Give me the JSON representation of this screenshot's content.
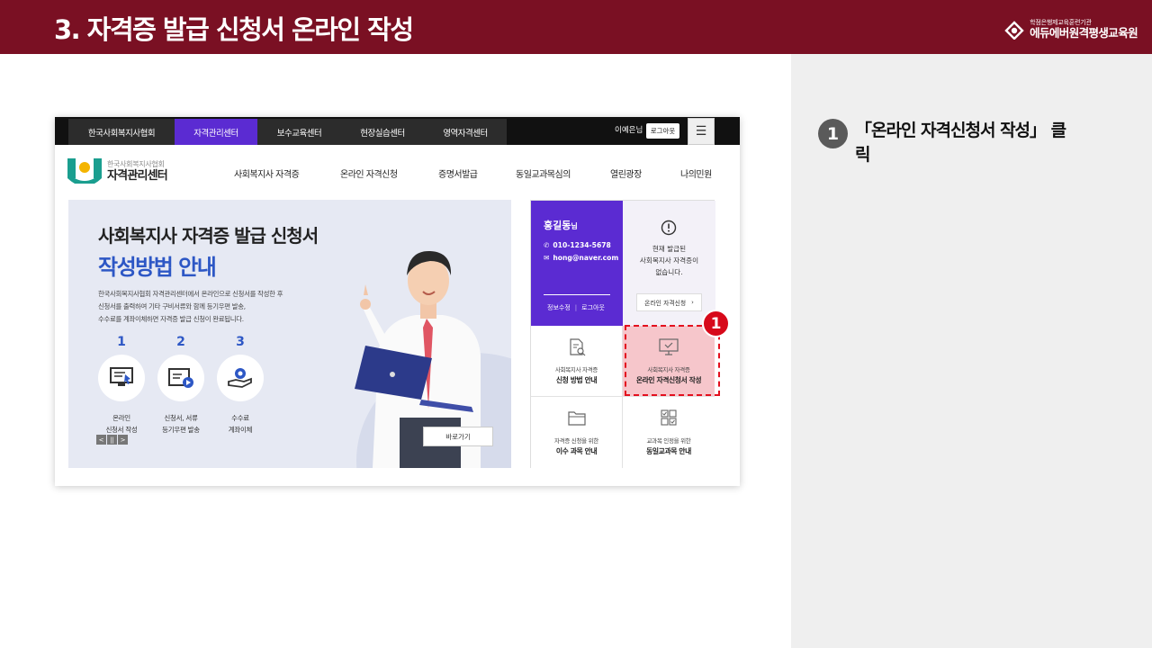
{
  "slide": {
    "title": "3. 자격증 발급 신청서 온라인 작성",
    "brand_sub": "학점은행제교육훈련기관",
    "brand_main": "에듀에버원격평생교육원"
  },
  "instruction": {
    "step_number": "1",
    "text": "「온라인 자격신청서 작성」 클릭"
  },
  "site": {
    "top_tabs": [
      {
        "label": "한국사회복지사협회",
        "active": false
      },
      {
        "label": "자격관리센터",
        "active": true
      },
      {
        "label": "보수교육센터",
        "active": false
      },
      {
        "label": "현장실습센터",
        "active": false
      },
      {
        "label": "영역자격센터",
        "active": false
      }
    ],
    "user_greeting": "이예은님",
    "logout_label": "로그아웃",
    "logo_sub": "한국사회복지사협회",
    "logo_main": "자격관리센터",
    "main_menu": [
      "사회복지사 자격증",
      "온라인 자격신청",
      "증명서발급",
      "동일교과목심의",
      "열린광장",
      "나의민원"
    ]
  },
  "banner": {
    "title": "사회복지사 자격증 발급 신청서",
    "subtitle": "작성방법 안내",
    "desc_line1": "한국사회복지사협회 자격관리센터에서  온라인으로 신청서를 작성한 후",
    "desc_line2": "신청서를 출력하여 기타 구비서류와 함께 등기우편 발송,",
    "desc_line3": "수수료를 계좌이체하면 자격증 발급 신청이 완료됩니다.",
    "steps": [
      {
        "num": "1",
        "line1": "온라인",
        "line2": "신청서 작성",
        "icon": "monitor-icon"
      },
      {
        "num": "2",
        "line1": "신청서, 서류",
        "line2": "등기우편 발송",
        "icon": "mail-icon"
      },
      {
        "num": "3",
        "line1": "수수료",
        "line2": "계좌이체",
        "icon": "coin-hand-icon"
      }
    ],
    "pager": [
      "<",
      "||",
      ">"
    ],
    "go_button": "바로가기"
  },
  "user_card": {
    "name": "홍길동",
    "name_suffix": "님",
    "phone": "010-1234-5678",
    "email": "hong@naver.com",
    "link_edit": "정보수정",
    "link_logout": "로그아웃"
  },
  "status_card": {
    "line1": "현재 발급된",
    "line2": "사회복지사 자격증이",
    "line3": "없습니다.",
    "button": "온라인 자격신청"
  },
  "grid": [
    {
      "small": "사회복지사 자격증",
      "bold": "신청 방법 안내",
      "icon": "document-search-icon"
    },
    {
      "small": "사회복지사 자격증",
      "bold": "온라인 자격신청서 작성",
      "icon": "monitor-check-icon"
    },
    {
      "small": "자격증 신청을 위한",
      "bold": "이수 과목 안내",
      "icon": "folder-icon"
    },
    {
      "small": "교과목 인정을 위한",
      "bold": "동일교과목 안내",
      "icon": "checklist-icon"
    }
  ],
  "marker_number": "1",
  "colors": {
    "header": "#7a1023",
    "accent_purple": "#5b2bd2",
    "highlight_red": "#e3101e",
    "banner_blue": "#2d57c5"
  }
}
